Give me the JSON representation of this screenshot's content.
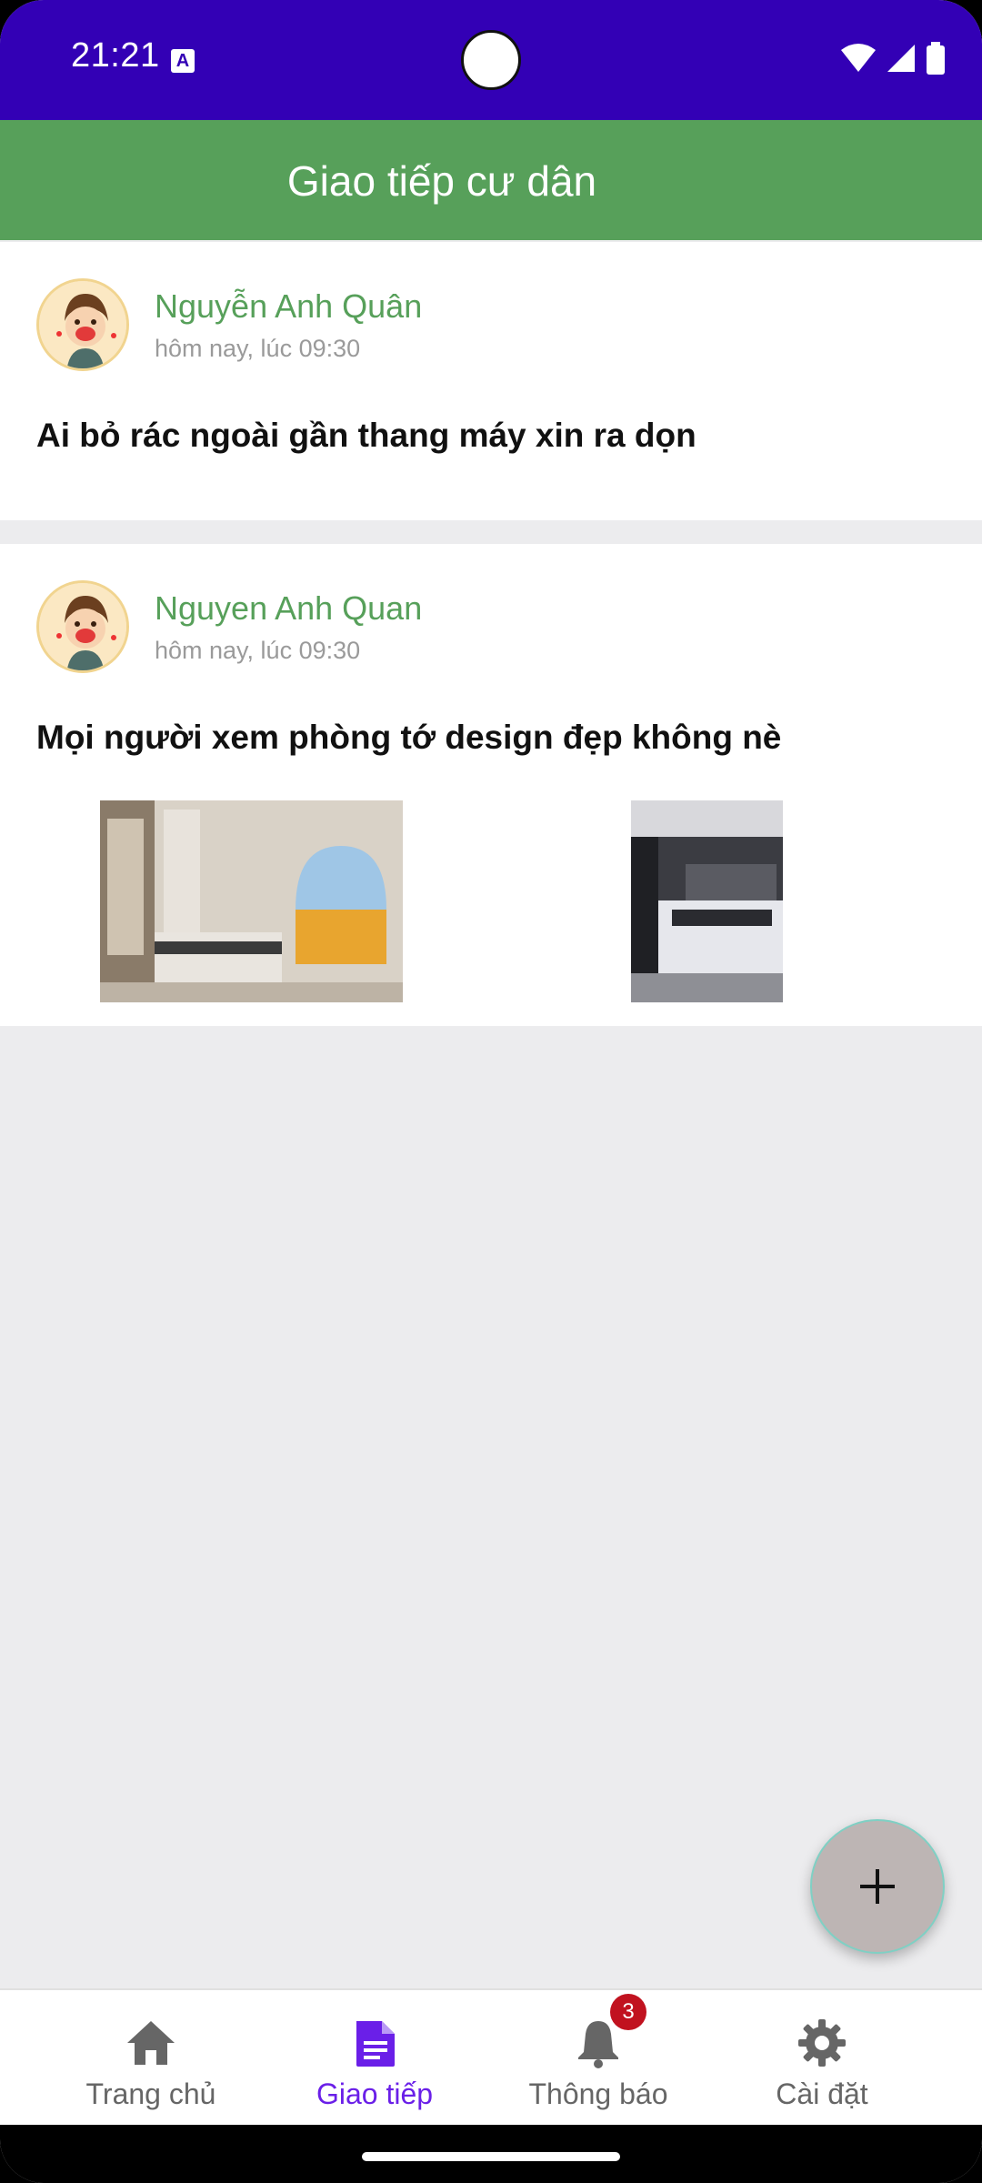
{
  "status_bar": {
    "time": "21:21",
    "a_badge": "A"
  },
  "app_bar": {
    "title": "Giao tiếp cư dân"
  },
  "posts": [
    {
      "author": "Nguyễn Anh Quân",
      "time": "hôm nay, lúc 09:30",
      "content": "Ai bỏ rác ngoài gần thang máy xin ra dọn"
    },
    {
      "author": "Nguyen Anh Quan",
      "time": "hôm nay, lúc 09:30",
      "content": "Mọi người xem phòng tớ design đẹp không nè"
    }
  ],
  "bottom_nav": {
    "items": [
      {
        "label": "Trang chủ",
        "icon": "home-icon"
      },
      {
        "label": "Giao tiếp",
        "icon": "document-icon"
      },
      {
        "label": "Thông báo",
        "icon": "bell-icon",
        "badge": "3"
      },
      {
        "label": "Cài đặt",
        "icon": "gear-icon"
      }
    ],
    "active_index": 1
  },
  "colors": {
    "status_bar": "#3300b5",
    "app_bar": "#57a05a",
    "author_name": "#57a05a",
    "nav_active": "#6a1fe8",
    "badge": "#c1121f"
  }
}
